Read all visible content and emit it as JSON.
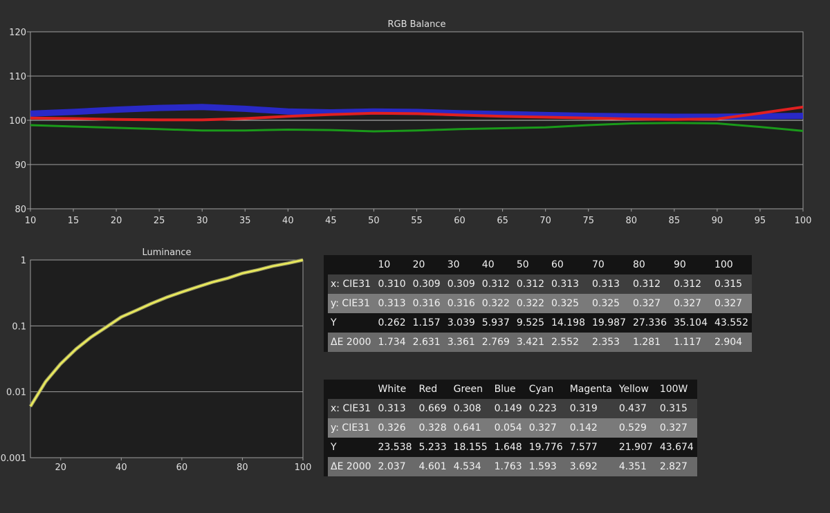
{
  "chart_data": [
    {
      "type": "line",
      "title": "RGB Balance",
      "x": [
        10,
        15,
        20,
        25,
        30,
        35,
        40,
        45,
        50,
        55,
        60,
        65,
        70,
        75,
        80,
        85,
        90,
        95,
        100
      ],
      "xticks": [
        10,
        15,
        20,
        25,
        30,
        35,
        40,
        45,
        50,
        55,
        60,
        65,
        70,
        75,
        80,
        85,
        90,
        95,
        100
      ],
      "ylim": [
        80,
        120
      ],
      "yticks": [
        80,
        90,
        100,
        110,
        120
      ],
      "xlim": [
        10,
        100
      ],
      "grid": "horizontal",
      "series": [
        {
          "color": "#2a2ad8",
          "values": [
            101.5,
            101.9,
            102.4,
            102.8,
            103.0,
            102.6,
            102.0,
            101.8,
            102.0,
            101.9,
            101.6,
            101.4,
            101.2,
            101.0,
            100.9,
            100.8,
            100.8,
            100.9,
            101.0
          ]
        },
        {
          "color": "#e02020",
          "values": [
            100.5,
            100.4,
            100.2,
            100.1,
            100.1,
            100.4,
            100.9,
            101.3,
            101.6,
            101.5,
            101.2,
            100.9,
            100.7,
            100.5,
            100.3,
            100.2,
            100.3,
            101.6,
            103.0
          ]
        },
        {
          "color": "#1a9a1a",
          "values": [
            98.9,
            98.6,
            98.3,
            98.0,
            97.7,
            97.7,
            97.9,
            97.8,
            97.5,
            97.7,
            98.0,
            98.2,
            98.4,
            98.9,
            99.3,
            99.4,
            99.3,
            98.5,
            97.6
          ]
        }
      ]
    },
    {
      "type": "line",
      "title": "Luminance",
      "yscale": "log",
      "xlim": [
        10,
        100
      ],
      "ylim": [
        0.001,
        1
      ],
      "xticks": [
        20,
        40,
        60,
        80,
        100
      ],
      "yticks": [
        0.001,
        0.01,
        0.1,
        1
      ],
      "ytick_labels": [
        "0.001",
        "0.01",
        "0.1",
        "1"
      ],
      "grid": "horizontal",
      "series": [
        {
          "color": "#ecec5a",
          "x": [
            10,
            15,
            20,
            25,
            30,
            35,
            40,
            45,
            50,
            55,
            60,
            65,
            70,
            75,
            80,
            85,
            90,
            95,
            100
          ],
          "values": [
            0.006,
            0.0142,
            0.0266,
            0.0442,
            0.0674,
            0.0955,
            0.1363,
            0.172,
            0.2187,
            0.2712,
            0.326,
            0.388,
            0.4589,
            0.526,
            0.6277,
            0.704,
            0.806,
            0.89,
            1.0
          ]
        }
      ]
    }
  ],
  "table_grayscale": {
    "headers": [
      "",
      "10",
      "20",
      "30",
      "40",
      "50",
      "60",
      "70",
      "80",
      "90",
      "100"
    ],
    "rows": [
      {
        "label": "x: CIE31",
        "values": [
          "0.310",
          "0.309",
          "0.309",
          "0.312",
          "0.312",
          "0.313",
          "0.313",
          "0.312",
          "0.312",
          "0.315"
        ]
      },
      {
        "label": "y: CIE31",
        "values": [
          "0.313",
          "0.316",
          "0.316",
          "0.322",
          "0.322",
          "0.325",
          "0.325",
          "0.327",
          "0.327",
          "0.327"
        ]
      },
      {
        "label": "Y",
        "values": [
          "0.262",
          "1.157",
          "3.039",
          "5.937",
          "9.525",
          "14.198",
          "19.987",
          "27.336",
          "35.104",
          "43.552"
        ]
      },
      {
        "label": "ΔE 2000",
        "values": [
          "1.734",
          "2.631",
          "3.361",
          "2.769",
          "3.421",
          "2.552",
          "2.353",
          "1.281",
          "1.117",
          "2.904"
        ]
      }
    ]
  },
  "table_colors": {
    "headers": [
      "",
      "White",
      "Red",
      "Green",
      "Blue",
      "Cyan",
      "Magenta",
      "Yellow",
      "100W"
    ],
    "rows": [
      {
        "label": "x: CIE31",
        "values": [
          "0.313",
          "0.669",
          "0.308",
          "0.149",
          "0.223",
          "0.319",
          "0.437",
          "0.315"
        ]
      },
      {
        "label": "y: CIE31",
        "values": [
          "0.326",
          "0.328",
          "0.641",
          "0.054",
          "0.327",
          "0.142",
          "0.529",
          "0.327"
        ]
      },
      {
        "label": "Y",
        "values": [
          "23.538",
          "5.233",
          "18.155",
          "1.648",
          "19.776",
          "7.577",
          "21.907",
          "43.674"
        ]
      },
      {
        "label": "ΔE 2000",
        "values": [
          "2.037",
          "4.601",
          "4.534",
          "1.763",
          "1.593",
          "3.692",
          "4.351",
          "2.827"
        ]
      }
    ]
  }
}
